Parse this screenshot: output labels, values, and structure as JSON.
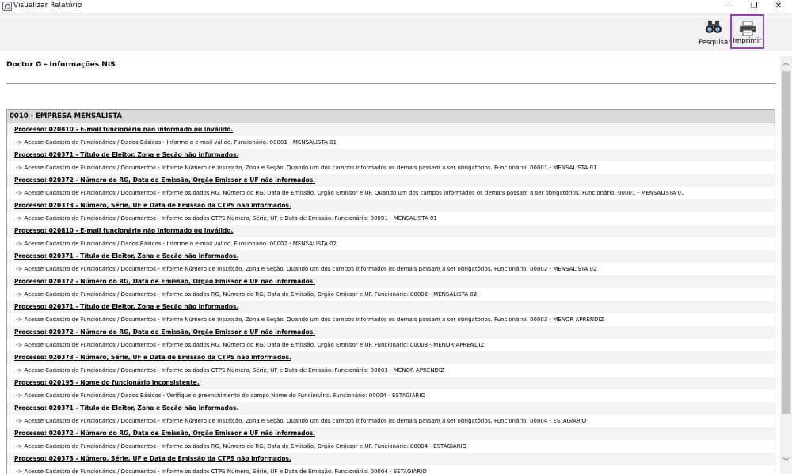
{
  "window": {
    "title": "Visualizar Relatório",
    "minimize_glyph": "—",
    "restore_glyph": "❐",
    "close_glyph": "✕"
  },
  "toolbar": {
    "search_label": "Pesquisar",
    "search_icon": "binoculars-icon",
    "print_label": "Imprimir",
    "print_icon": "printer-icon",
    "highlight_color": "#8e44ad"
  },
  "report": {
    "title": "Doctor G - Informações NIS",
    "section": "0010 - EMPRESA MENSALISTA",
    "rows": [
      {
        "type": "proc",
        "text": "Processo: 020810 - E-mail funcionário não informado ou inválido."
      },
      {
        "type": "instr",
        "text": " -> Acesse Cadastro de Funcionários / Dados Básicos - Informe o e-mail válido. Funcionário: 00001 - MENSALISTA 01"
      },
      {
        "type": "proc",
        "text": "Processo: 020371 - Título de Eleitor, Zona e Seção não informados."
      },
      {
        "type": "instr",
        "text": " -> Acesse Cadastro de Funcionários / Documentos - Informe Número de Inscrição, Zona e Seção. Quando um dos campos informados os demais passam a ser obrigatórios. Funcionário: 00001 - MENSALISTA 01"
      },
      {
        "type": "proc",
        "text": "Processo: 020372 - Número do RG, Data de Emissão, Orgão Emissor e UF não informados."
      },
      {
        "type": "instr",
        "text": " -> Acesse Cadastro de Funcionários / Documentos - Informe os dados RG, Número do RG, Data de Emissão, Orgão Emissor e UF. Quando um dos campos informados os demais passam a ser obrigatórios. Funcionário: 00001 - MENSALISTA 01"
      },
      {
        "type": "proc",
        "text": "Processo: 020373 - Número, Série, UF e Data de Emissão da CTPS não informados."
      },
      {
        "type": "instr",
        "text": " -> Acesse Cadastro de Funcionários / Documentos - Informe os dados CTPS Número, Série, UF e Data de Emissão. Funcionário: 00001 - MENSALISTA 01"
      },
      {
        "type": "proc",
        "text": "Processo: 020810 - E-mail funcionário não informado ou inválido."
      },
      {
        "type": "instr",
        "text": " -> Acesse Cadastro de Funcionários / Dados Básicos - Informe o e-mail válido. Funcionário: 00002 - MENSALISTA 02"
      },
      {
        "type": "proc",
        "text": "Processo: 020371 - Título de Eleitor, Zona e Seção não informados."
      },
      {
        "type": "instr",
        "text": " -> Acesse Cadastro de Funcionários / Documentos - Informe Número de Inscrição, Zona e Seção. Quando um dos campos informados os demais passam a ser obrigatórios. Funcionário: 00002 - MENSALISTA 02"
      },
      {
        "type": "proc",
        "text": "Processo: 020372 - Número do RG, Data de Emissão, Orgão Emissor e UF não informados."
      },
      {
        "type": "instr",
        "text": " -> Acesse Cadastro de Funcionários / Documentos - Informe os dados RG, Número do RG, Data de Emissão, Orgão Emissor e UF. Funcionário: 00002 - MENSALISTA 02"
      },
      {
        "type": "proc",
        "text": "Processo: 020371 - Título de Eleitor, Zona e Seção não informados."
      },
      {
        "type": "instr",
        "text": " -> Acesse Cadastro de Funcionários / Documentos - Informe Número de Inscrição, Zona e Seção. Quando um dos campos informados os demais passam a ser obrigatórios. Funcionário: 00003 - MENOR APRENDIZ"
      },
      {
        "type": "proc",
        "text": "Processo: 020372 - Número do RG, Data de Emissão, Orgão Emissor e UF não informados."
      },
      {
        "type": "instr",
        "text": " -> Acesse Cadastro de Funcionários / Documentos - Informe os dados RG, Número do RG, Data de Emissão, Orgão Emissor e UF. Funcionário: 00003 - MENOR APRENDIZ"
      },
      {
        "type": "proc",
        "text": "Processo: 020373 - Número, Série, UF e Data de Emissão da CTPS não informados."
      },
      {
        "type": "instr",
        "text": " -> Acesse Cadastro de Funcionários / Documentos - Informe os dados CTPS Número, Série, UF e Data de Emissão. Funcionário: 00003 - MENOR APRENDIZ"
      },
      {
        "type": "proc",
        "text": "Processo: 020195 - Nome do funcionário inconsistente."
      },
      {
        "type": "instr",
        "text": " -> Acesse Cadastro de Funcionários / Dados Básicos - Verifique o preenchimento do campo Nome do Funcionário. Funcionário: 00004 - ESTAGIÁRIO"
      },
      {
        "type": "proc",
        "text": "Processo: 020371 - Título de Eleitor, Zona e Seção não informados."
      },
      {
        "type": "instr",
        "text": " -> Acesse Cadastro de Funcionários / Documentos - Informe Número de Inscrição, Zona e Seção. Quando um dos campos informados os demais passam a ser obrigatórios. Funcionário: 00004 - ESTAGIÁRIO"
      },
      {
        "type": "proc",
        "text": "Processo: 020372 - Número do RG, Data de Emissão, Orgão Emissor e UF não informados."
      },
      {
        "type": "instr",
        "text": " -> Acesse Cadastro de Funcionários / Documentos - Informe os dados RG, Número do RG, Data de Emissão, Orgão Emissor e UF. Funcionário: 00004 - ESTAGIÁRIO"
      },
      {
        "type": "proc",
        "text": "Processo: 020373 - Número, Série, UF e Data de Emissão da CTPS não informados."
      },
      {
        "type": "instr",
        "text": " -> Acesse Cadastro de Funcionários / Documentos - Informe os dados CTPS Número, Série, UF e Data de Emissão. Funcionário: 00004 - ESTAGIÁRIO"
      }
    ]
  },
  "scrollbar": {
    "up_glyph": "︿",
    "down_glyph": "﹀"
  }
}
